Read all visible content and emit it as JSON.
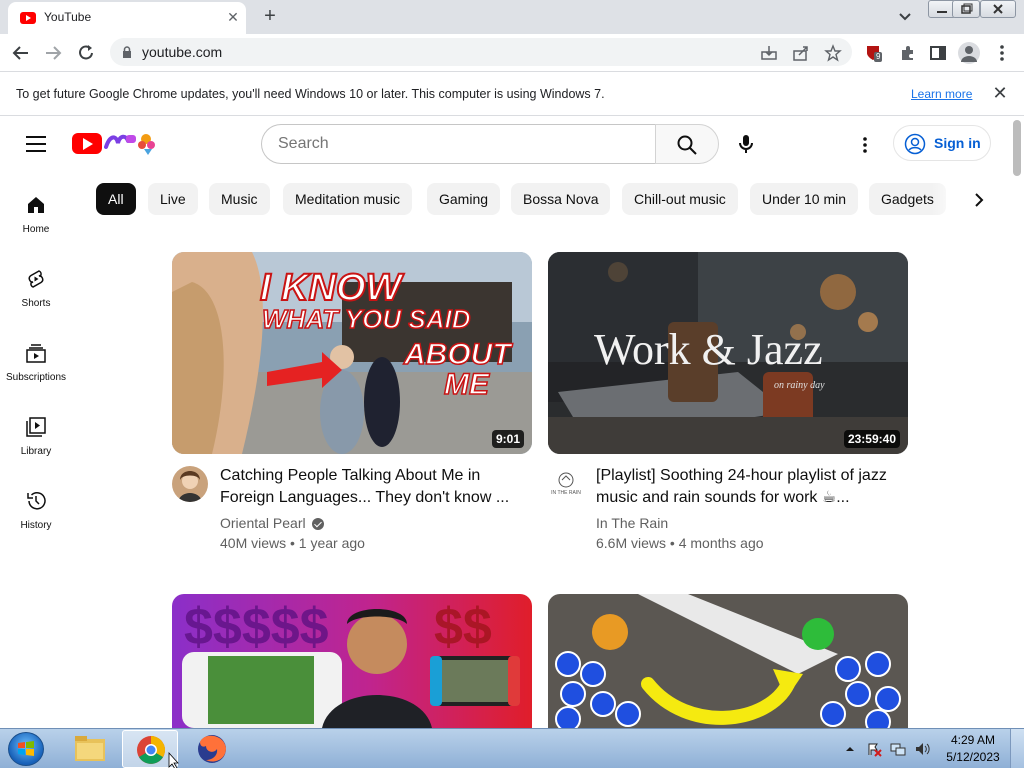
{
  "browser": {
    "tab_title": "YouTube",
    "url": "youtube.com",
    "extension_badge": "9"
  },
  "infobar": {
    "message": "To get future Google Chrome updates, you'll need Windows 10 or later. This computer is using Windows 7.",
    "link": "Learn more"
  },
  "youtube": {
    "search_placeholder": "Search",
    "sign_in": "Sign in",
    "chips": [
      "All",
      "Live",
      "Music",
      "Meditation music",
      "Gaming",
      "Bossa Nova",
      "Chill-out music",
      "Under 10 min",
      "Gadgets"
    ],
    "guide": [
      "Home",
      "Shorts",
      "Subscriptions",
      "Library",
      "History"
    ],
    "videos": [
      {
        "thumb_text": [
          "I KNOW",
          "WHAT YOU SAID",
          "ABOUT",
          "ME"
        ],
        "duration": "9:01",
        "title": "Catching People Talking About Me in Foreign Languages... They don't know ...",
        "channel": "Oriental Pearl",
        "meta": "40M views • 1 year ago"
      },
      {
        "thumb_text": [
          "Work & Jazz",
          "on rainy day"
        ],
        "duration": "23:59:40",
        "title": "[Playlist] Soothing 24-hour playlist of jazz music and rain sounds for work ☕...",
        "channel": "In The Rain",
        "avatar_text": "IN THE RAIN",
        "meta": "6.6M views • 4 months ago"
      },
      {
        "thumb_text": [
          "$$$$$",
          "$$"
        ]
      },
      {
        "thumb_text": []
      }
    ]
  },
  "taskbar": {
    "time": "4:29 AM",
    "date": "5/12/2023"
  }
}
